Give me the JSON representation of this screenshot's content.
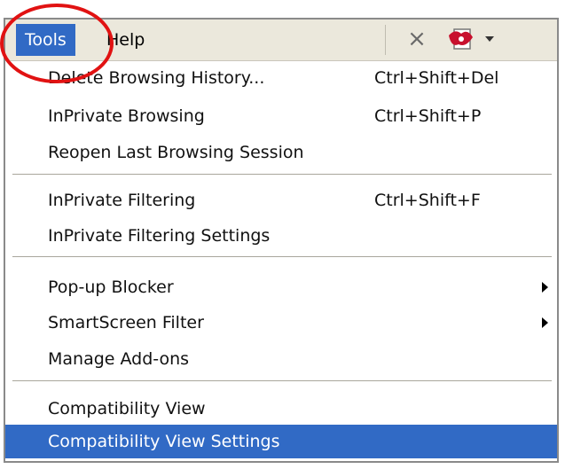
{
  "menubar": {
    "tools_label": "Tools",
    "help_label": "Help",
    "icons": [
      "close-icon",
      "pdf-icon",
      "dropdown-arrow-icon"
    ]
  },
  "menu": {
    "groups": [
      [
        {
          "label": "Delete Browsing History...",
          "shortcut": "Ctrl+Shift+Del"
        },
        {
          "label": "InPrivate Browsing",
          "shortcut": "Ctrl+Shift+P"
        },
        {
          "label": "Reopen Last Browsing Session",
          "shortcut": ""
        }
      ],
      [
        {
          "label": "InPrivate Filtering",
          "shortcut": "Ctrl+Shift+F"
        },
        {
          "label": "InPrivate Filtering Settings",
          "shortcut": ""
        }
      ],
      [
        {
          "label": "Pop-up Blocker",
          "shortcut": "",
          "submenu": true
        },
        {
          "label": "SmartScreen Filter",
          "shortcut": "",
          "submenu": true
        },
        {
          "label": "Manage Add-ons",
          "shortcut": ""
        }
      ],
      [
        {
          "label": "Compatibility View",
          "shortcut": ""
        },
        {
          "label": "Compatibility View Settings",
          "shortcut": "",
          "selected": true
        }
      ]
    ]
  },
  "colors": {
    "menubar_bg": "#ebe8dc",
    "selection": "#316ac5",
    "annotation_ring": "#e11212"
  }
}
